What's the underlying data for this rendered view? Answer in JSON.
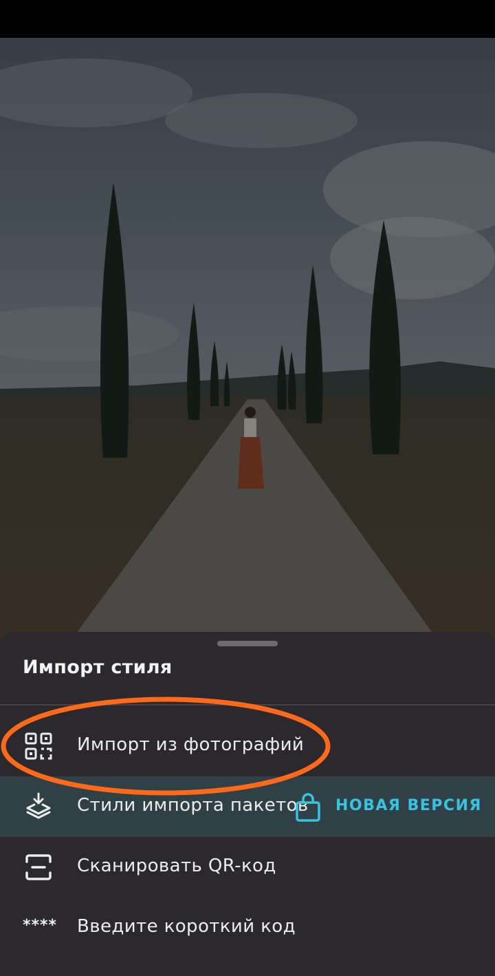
{
  "sheet": {
    "title": "Импорт стиля",
    "items": [
      {
        "label": "Импорт из фотографий",
        "icon": "qr-gallery-icon"
      },
      {
        "label": "Стили импорта пакетов",
        "icon": "layers-download-icon",
        "badge": "НОВАЯ ВЕРСИЯ",
        "badge_icon": "shopping-bag-icon"
      },
      {
        "label": "Сканировать QR-код",
        "icon": "scan-frame-icon"
      },
      {
        "label": "Введите короткий код",
        "icon": "****"
      }
    ]
  },
  "colors": {
    "sheet_bg": "#2b292d",
    "highlight_row": "#2f4146",
    "accent": "#39c3e0",
    "annotation": "#ff6a1a"
  }
}
